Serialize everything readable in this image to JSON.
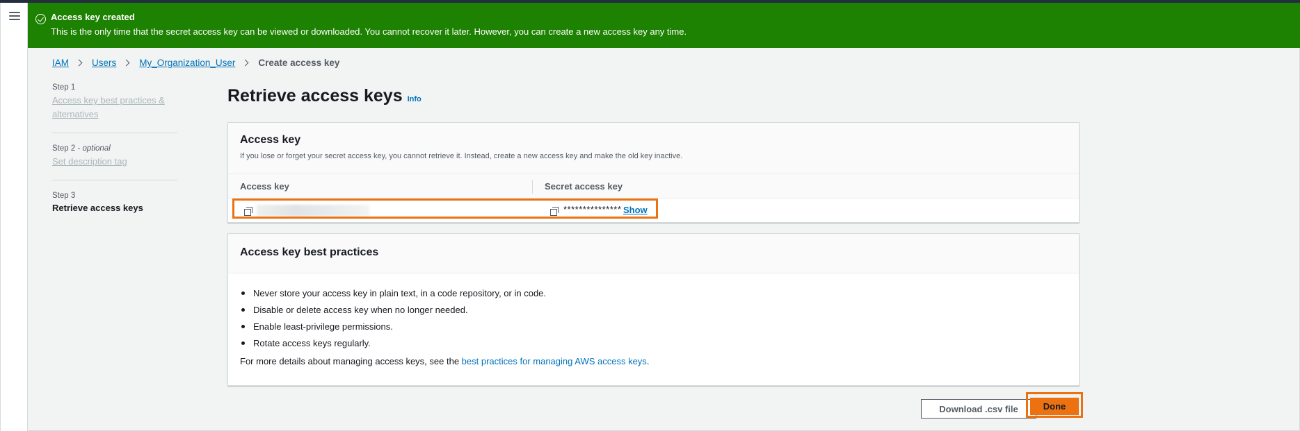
{
  "flash": {
    "title": "Access key created",
    "message": "This is the only time that the secret access key can be viewed or downloaded. You cannot recover it later. However, you can create a new access key any time."
  },
  "breadcrumb": {
    "items": [
      "IAM",
      "Users",
      "My_Organization_User"
    ],
    "current": "Create access key"
  },
  "steps": [
    {
      "small": "Step 1",
      "label": "Access key best practices & alternatives"
    },
    {
      "small": "Step 2",
      "optional": "optional",
      "label": "Set description tag"
    },
    {
      "small": "Step 3",
      "label": "Retrieve access keys"
    }
  ],
  "page": {
    "title": "Retrieve access keys",
    "info_link": "Info"
  },
  "access_key_panel": {
    "title": "Access key",
    "description": "If you lose or forget your secret access key, you cannot retrieve it. Instead, create a new access key and make the old key inactive.",
    "col_access_key": "Access key",
    "col_secret_key": "Secret access key",
    "secret_masked": "***************",
    "show_link": "Show"
  },
  "best_practices_panel": {
    "title": "Access key best practices",
    "items": [
      "Never store your access key in plain text, in a code repository, or in code.",
      "Disable or delete access key when no longer needed.",
      "Enable least-privilege permissions.",
      "Rotate access keys regularly."
    ],
    "more_prefix": "For more details about managing access keys, see the ",
    "more_link": "best practices for managing AWS access keys",
    "more_suffix": "."
  },
  "actions": {
    "download_label": "Download .csv file",
    "done_label": "Done"
  },
  "colors": {
    "success": "#1d8102",
    "link": "#0073bb",
    "primary": "#ec7211",
    "highlight": "#ec7211"
  }
}
